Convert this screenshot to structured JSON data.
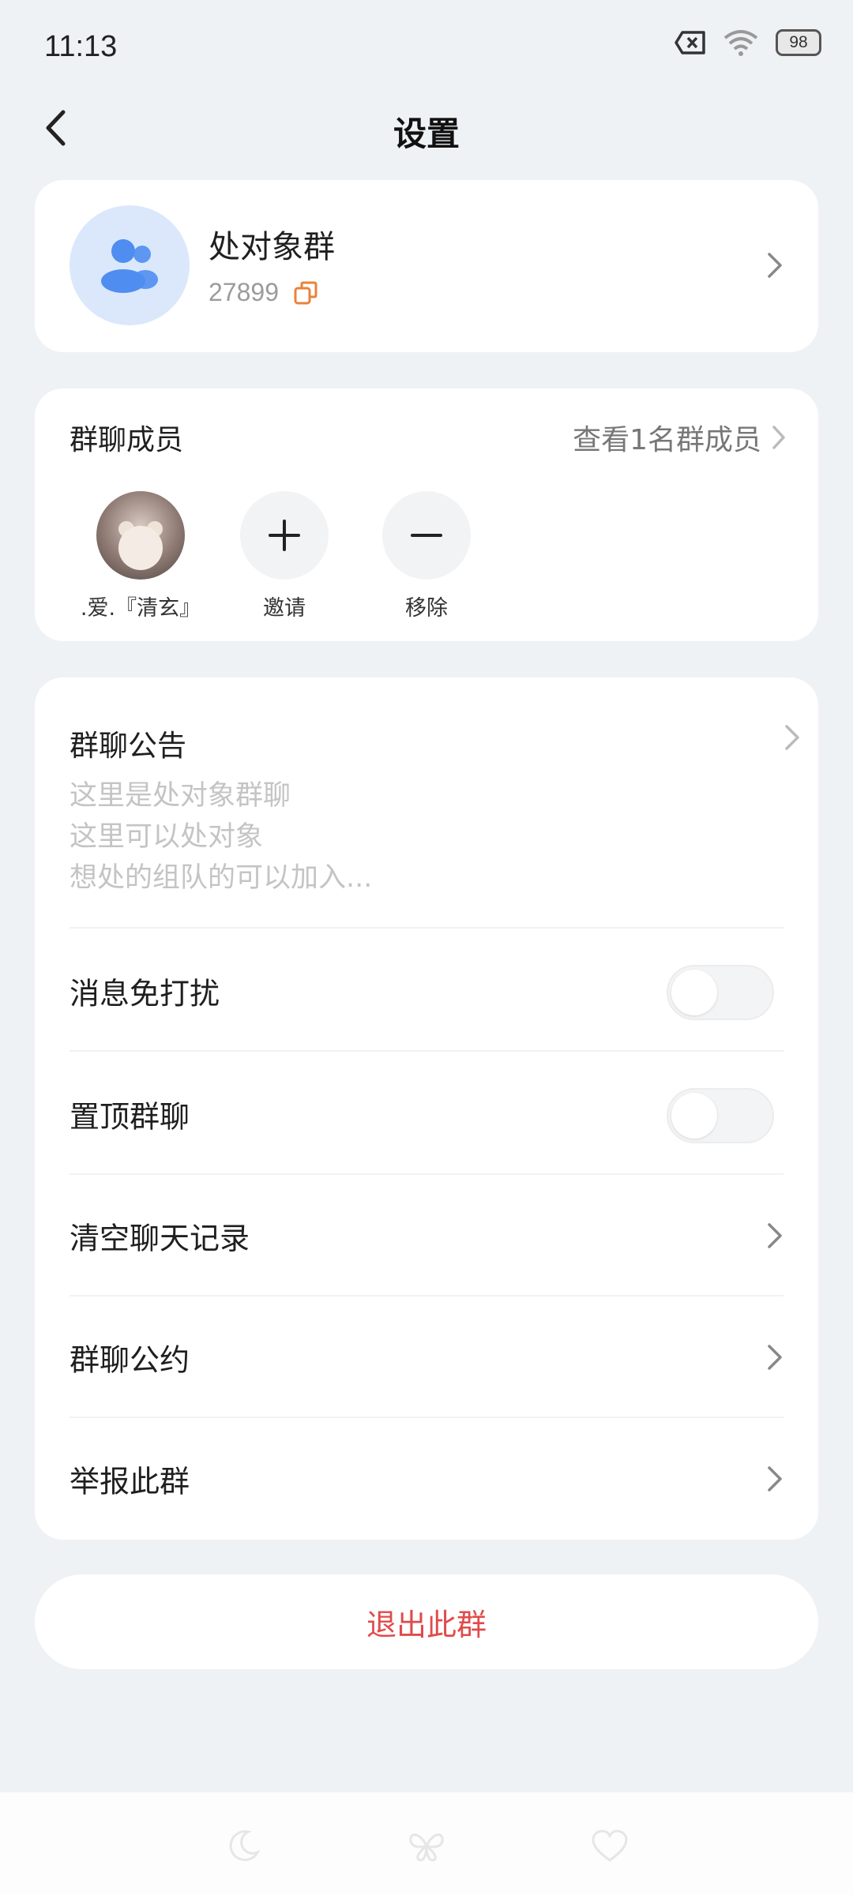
{
  "status_bar": {
    "time": "11:13",
    "battery": "98"
  },
  "header": {
    "title": "设置"
  },
  "group": {
    "name": "处对象群",
    "id": "27899"
  },
  "members": {
    "title": "群聊成员",
    "view_all": "查看1名群成员",
    "items": [
      {
        "label": ".爱.『清玄』"
      },
      {
        "label": "邀请"
      },
      {
        "label": "移除"
      }
    ]
  },
  "settings": {
    "announcement": {
      "title": "群聊公告",
      "lines": [
        "这里是处对象群聊",
        "这里可以处对象",
        "想处的组队的可以加入..."
      ]
    },
    "mute": {
      "label": "消息免打扰",
      "on": false
    },
    "pin": {
      "label": "置顶群聊",
      "on": false
    },
    "clear_history": "清空聊天记录",
    "rules": "群聊公约",
    "report": "举报此群"
  },
  "exit_button": "退出此群",
  "colors": {
    "accent_blue": "#4f8ef0",
    "danger": "#e04b4b",
    "copy_orange": "#e8833a"
  },
  "bottom_icons": [
    "moon-icon",
    "butterfly-icon",
    "heart-icon"
  ]
}
